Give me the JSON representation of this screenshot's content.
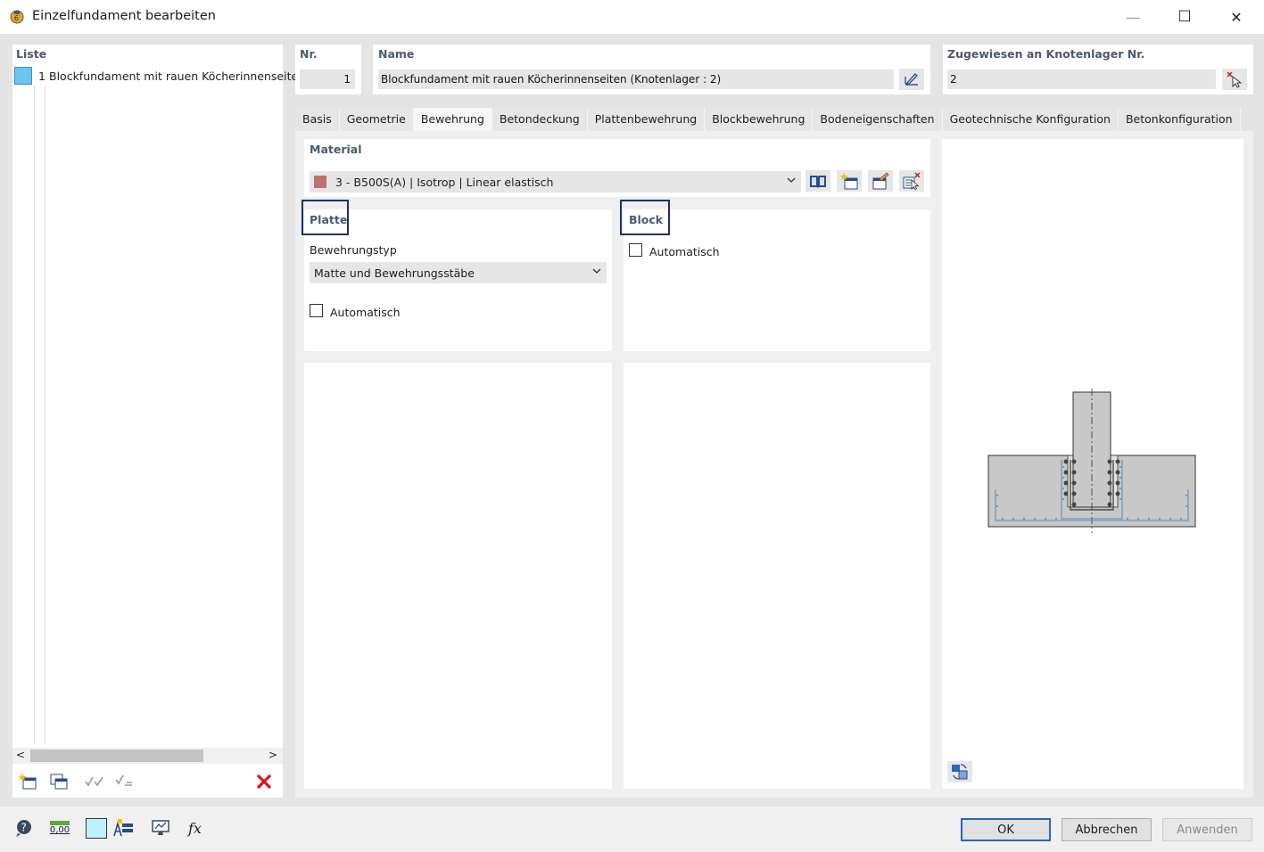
{
  "window": {
    "title": "Einzelfundament bearbeiten",
    "minimize_glyph": "—",
    "maximize_glyph": "☐",
    "close_glyph": "✕"
  },
  "list": {
    "header": "Liste",
    "items": [
      {
        "number": "1",
        "label": "Blockfundament mit rauen Köcherinnenseiten"
      }
    ],
    "scroll_left": "<",
    "scroll_right": ">"
  },
  "nr": {
    "label": "Nr.",
    "value": "1"
  },
  "name": {
    "label": "Name",
    "value": "Blockfundament mit rauen Köcherinnenseiten (Knotenlager : 2)"
  },
  "assigned": {
    "label": "Zugewiesen an Knotenlager Nr.",
    "value": "2"
  },
  "tabs": [
    {
      "label": "Basis"
    },
    {
      "label": "Geometrie"
    },
    {
      "label": "Bewehrung"
    },
    {
      "label": "Betondeckung"
    },
    {
      "label": "Plattenbewehrung"
    },
    {
      "label": "Blockbewehrung"
    },
    {
      "label": "Bodeneigenschaften"
    },
    {
      "label": "Geotechnische Konfiguration"
    },
    {
      "label": "Betonkonfiguration"
    }
  ],
  "active_tab": "Bewehrung",
  "material": {
    "header": "Material",
    "selected": "3 - B500S(A) | Isotrop | Linear elastisch",
    "swatch_color": "#c07070"
  },
  "platte": {
    "header": "Platte",
    "type_label": "Bewehrungstyp",
    "type_value": "Matte und Bewehrungsstäbe",
    "auto_label": "Automatisch"
  },
  "block": {
    "header": "Block",
    "auto_label": "Automatisch"
  },
  "buttons": {
    "ok": "OK",
    "cancel": "Abbrechen",
    "apply": "Anwenden"
  },
  "bottom_toolbar": {
    "units_label": "0,00"
  },
  "colors": {
    "accent_border": "#1f2d75",
    "delete_red": "#d9141a",
    "list_selection": "#6cc4f0"
  }
}
